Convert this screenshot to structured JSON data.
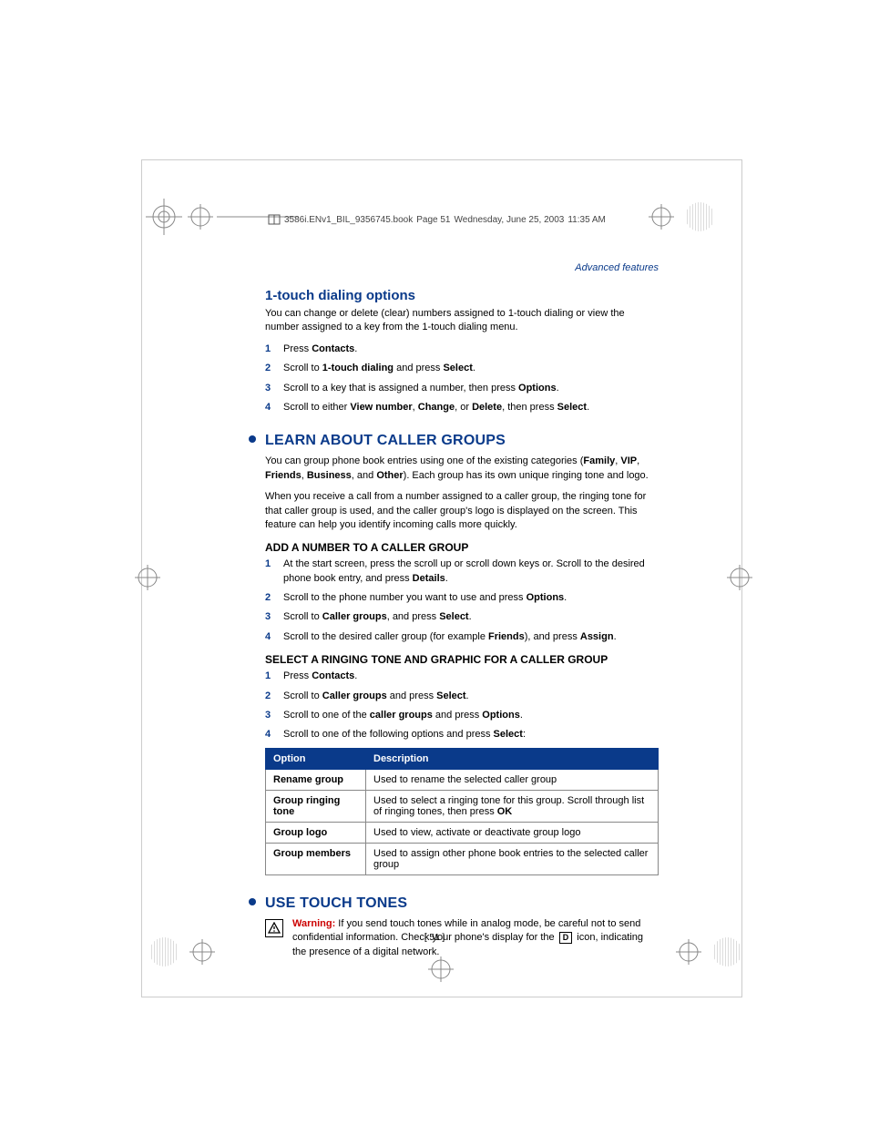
{
  "header": {
    "file": "3586i.ENv1_BIL_9356745.book",
    "page_info": "Page 51",
    "date": "Wednesday, June 25, 2003",
    "time": "11:35 AM"
  },
  "breadcrumb": "Advanced features",
  "section1": {
    "title": "1-touch dialing options",
    "intro": "You can change or delete (clear) numbers assigned to 1-touch dialing or view the number assigned to a key from the 1-touch dialing menu.",
    "steps": {
      "s1a": "Press ",
      "s1b": "Contacts",
      "s1c": ".",
      "s2a": "Scroll to ",
      "s2b": "1-touch dialing",
      "s2c": " and press ",
      "s2d": "Select",
      "s2e": ".",
      "s3a": "Scroll to a key that is assigned a number, then press ",
      "s3b": "Options",
      "s3c": ".",
      "s4a": "Scroll to either ",
      "s4b": "View number",
      "s4c": ", ",
      "s4d": "Change",
      "s4e": ", or ",
      "s4f": "Delete",
      "s4g": ", then press ",
      "s4h": "Select",
      "s4i": "."
    }
  },
  "section2": {
    "title": "Learn About Caller Groups",
    "p1a": "You can group phone book entries using one of the existing categories (",
    "p1b": "Family",
    "p1c": ", ",
    "p1d": "VIP",
    "p1e": ", ",
    "p1f": "Friends",
    "p1g": ", ",
    "p1h": "Business",
    "p1i": ", and ",
    "p1j": "Other",
    "p1k": "). Each group has its own unique ringing tone and logo.",
    "p2": "When you receive a call from a number assigned to a caller group, the ringing tone for that caller group is used, and the caller group's logo is displayed on the screen. This feature can help you identify incoming calls more quickly.",
    "sub1": {
      "title": "Add a number to a caller group",
      "s1a": "At the start screen, press the scroll up or scroll down keys or. Scroll to the desired phone book entry, and press ",
      "s1b": "Details",
      "s1c": ".",
      "s2a": "Scroll to the phone number you want to use and press ",
      "s2b": "Options",
      "s2c": ".",
      "s3a": "Scroll to ",
      "s3b": "Caller groups",
      "s3c": ", and press ",
      "s3d": "Select",
      "s3e": ".",
      "s4a": "Scroll to the desired caller group (for example ",
      "s4b": "Friends",
      "s4c": "), and press ",
      "s4d": "Assign",
      "s4e": "."
    },
    "sub2": {
      "title": "Select a ringing tone and graphic for a caller group",
      "s1a": "Press ",
      "s1b": "Contacts",
      "s1c": ".",
      "s2a": "Scroll to ",
      "s2b": "Caller groups",
      "s2c": " and press ",
      "s2d": "Select",
      "s2e": ".",
      "s3a": "Scroll to one of the ",
      "s3b": "caller groups",
      "s3c": " and press ",
      "s3d": "Options",
      "s3e": ".",
      "s4a": "Scroll to one of the following options and press ",
      "s4b": "Select",
      "s4c": ":"
    },
    "table": {
      "head": {
        "c1": "Option",
        "c2": "Description"
      },
      "rows": [
        {
          "c1": "Rename group",
          "c2": "Used to rename the selected caller group"
        },
        {
          "c1": "Group ringing tone",
          "c2a": "Used to select a ringing tone for this group. Scroll through list of ringing tones, then press ",
          "c2b": "OK"
        },
        {
          "c1": "Group logo",
          "c2": "Used to view, activate or deactivate group logo"
        },
        {
          "c1": "Group members",
          "c2": "Used to assign other phone book entries to the selected caller group"
        }
      ]
    }
  },
  "section3": {
    "title": "Use Touch Tones",
    "warn_label": "Warning:",
    "warn_a": " If you send touch tones while in analog mode, be careful not to send confidential information. Check your phone's display for the ",
    "warn_d": "D",
    "warn_b": " icon, indicating the presence of a digital network."
  },
  "footer": "[ 51 ]"
}
